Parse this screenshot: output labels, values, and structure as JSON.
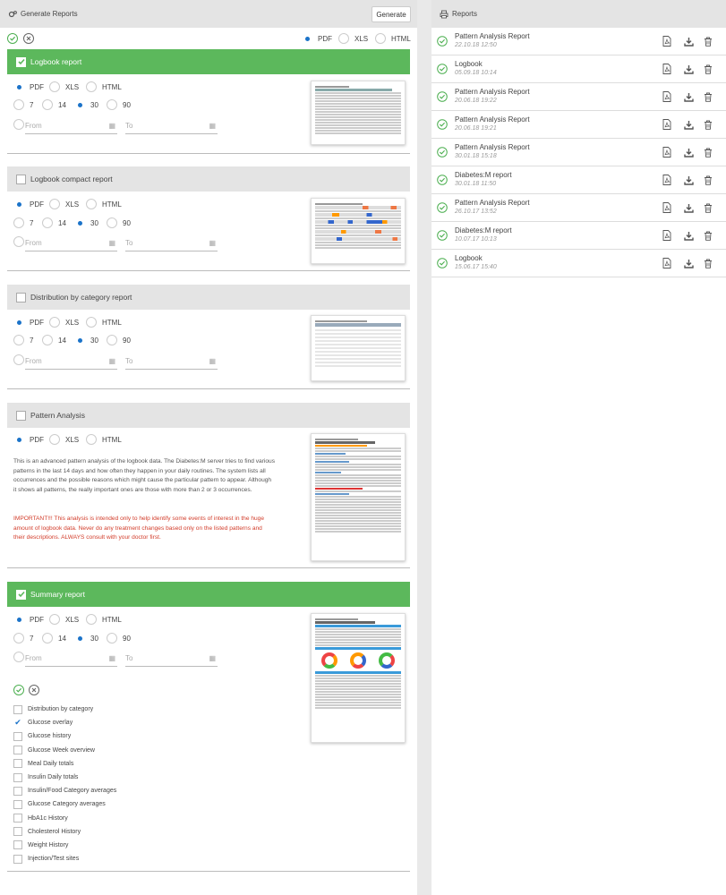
{
  "left": {
    "title": "Generate Reports",
    "generate_label": "Generate"
  },
  "top_formats": [
    "PDF",
    "XLS",
    "HTML"
  ],
  "sections": {
    "logbook": {
      "title": "Logbook report"
    },
    "compact": {
      "title": "Logbook compact report"
    },
    "distribution": {
      "title": "Distribution by category report"
    },
    "pattern": {
      "title": "Pattern Analysis"
    },
    "summary": {
      "title": "Summary report"
    }
  },
  "formats": {
    "pdf": "PDF",
    "xls": "XLS",
    "html": "HTML"
  },
  "periods": {
    "p7": "7",
    "p14": "14",
    "p30": "30",
    "p90": "90"
  },
  "dates": {
    "from": "From",
    "to": "To"
  },
  "pattern_desc": "This is an advanced pattern analysis of the logbook data. The Diabetes:M server tries to find various patterns in the last 14 days and how often they happen in your daily routines. The system lists all occurrences and the possible reasons which might cause the particular pattern to appear. Although it shows all patterns, the really important ones are those with more than 2 or 3 occurrences.",
  "pattern_warning": "IMPORTANT!!! This analysis is intended only to help identify some events of interest in the huge amount of logbook data. Never do any treatment changes based only on the listed patterns and their descriptions. ALWAYS consult with your doctor first.",
  "summary_items": [
    {
      "label": "Distribution by category",
      "checked": false
    },
    {
      "label": "Glucose overlay",
      "checked": true
    },
    {
      "label": "Glucose history",
      "checked": false
    },
    {
      "label": "Glucose Week overview",
      "checked": false
    },
    {
      "label": "Meal Daily totals",
      "checked": false
    },
    {
      "label": "Insulin Daily totals",
      "checked": false
    },
    {
      "label": "Insulin/Food Category averages",
      "checked": false
    },
    {
      "label": "Glucose Category averages",
      "checked": false
    },
    {
      "label": "HbA1c History",
      "checked": false
    },
    {
      "label": "Cholesterol History",
      "checked": false
    },
    {
      "label": "Weight History",
      "checked": false
    },
    {
      "label": "Injection/Test sites",
      "checked": false
    }
  ],
  "right": {
    "title": "Reports"
  },
  "reports": [
    {
      "name": "Pattern Analysis Report",
      "date": "22.10.18 12:50"
    },
    {
      "name": "Logbook",
      "date": "05.09.18 10:14"
    },
    {
      "name": "Pattern Analysis Report",
      "date": "20.06.18 19:22"
    },
    {
      "name": "Pattern Analysis Report",
      "date": "20.06.18 19:21"
    },
    {
      "name": "Pattern Analysis Report",
      "date": "30.01.18 15:18"
    },
    {
      "name": "Diabetes:M report",
      "date": "30.01.18 11:50"
    },
    {
      "name": "Pattern Analysis Report",
      "date": "26.10.17 13:52"
    },
    {
      "name": "Diabetes:M report",
      "date": "10.07.17 10:13"
    },
    {
      "name": "Logbook",
      "date": "15.06.17 15:40"
    }
  ],
  "colors": {
    "accent_green": "#5cb85c",
    "radio_blue": "#1b73c9",
    "warning_red": "#d23c2a"
  }
}
